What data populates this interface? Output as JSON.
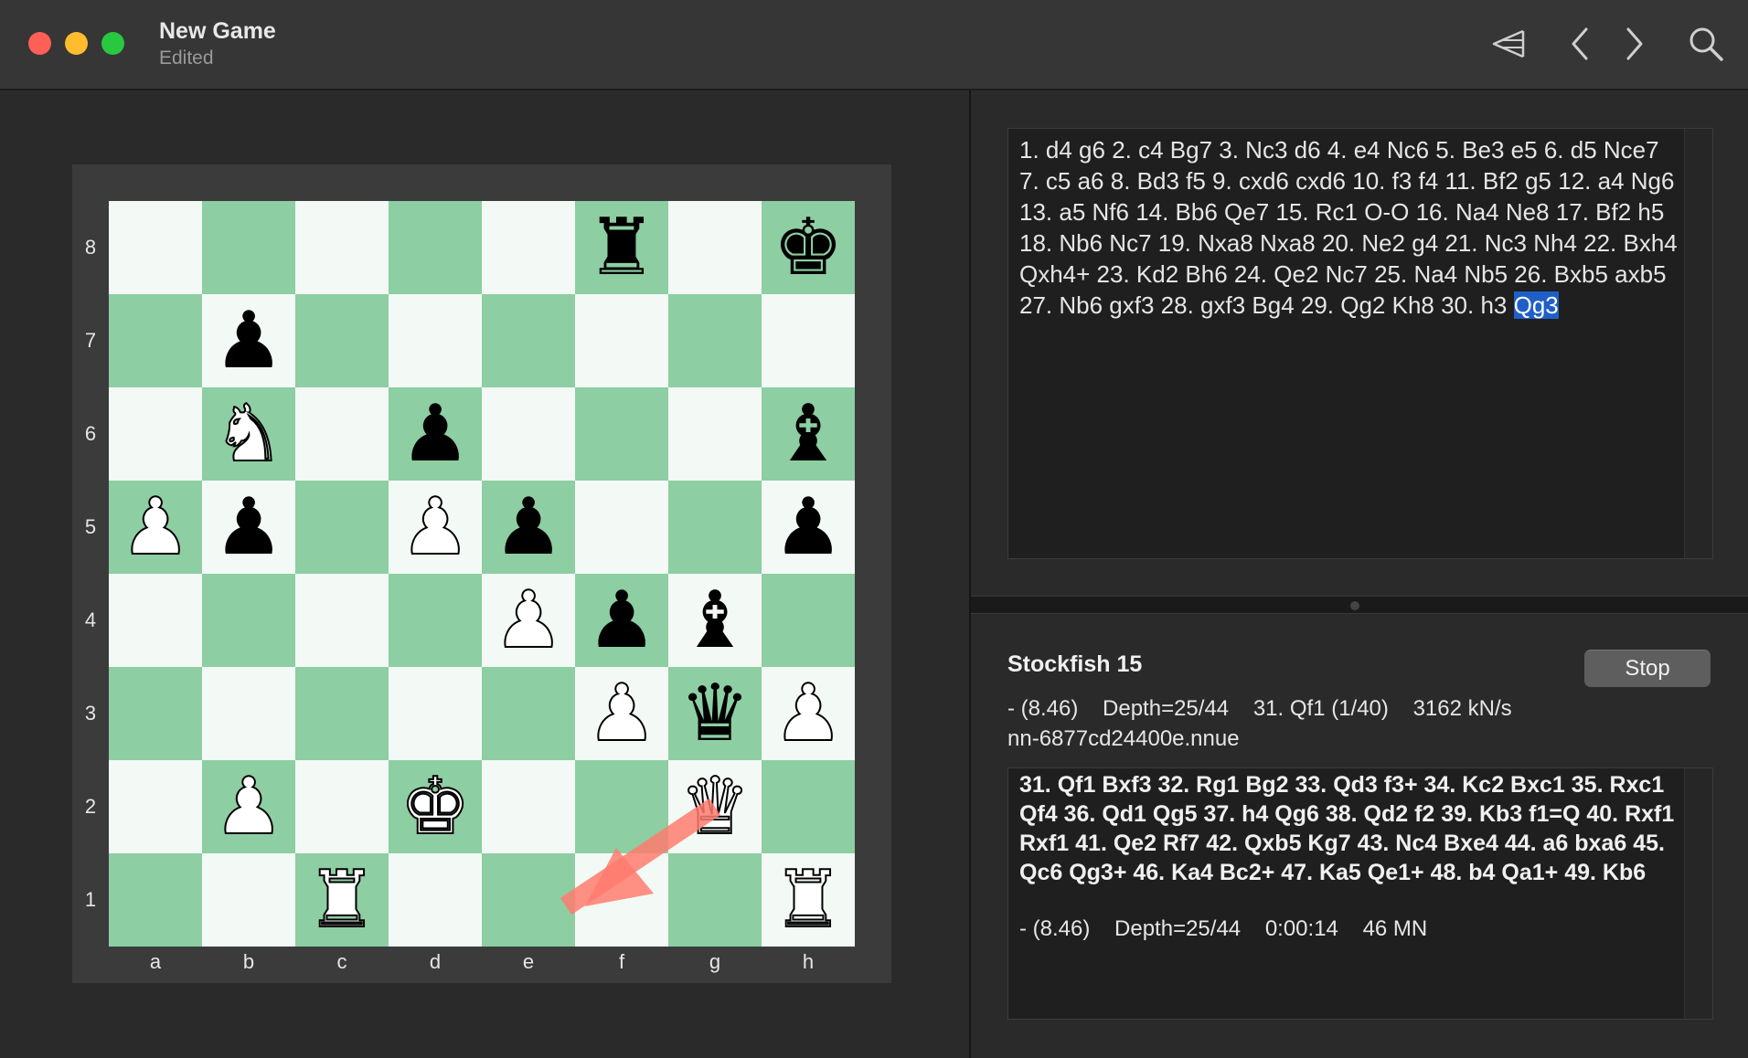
{
  "window": {
    "title": "New Game",
    "subtitle": "Edited"
  },
  "toolbar": {
    "icons": [
      "flip-board-icon",
      "chevron-left-icon",
      "chevron-right-icon",
      "search-icon"
    ]
  },
  "board": {
    "ranks": [
      "8",
      "7",
      "6",
      "5",
      "4",
      "3",
      "2",
      "1"
    ],
    "files": [
      "a",
      "b",
      "c",
      "d",
      "e",
      "f",
      "g",
      "h"
    ],
    "rows": [
      [
        "",
        "",
        "",
        "",
        "",
        "r",
        "",
        "k"
      ],
      [
        "",
        "p",
        "",
        "",
        "",
        "",
        "",
        ""
      ],
      [
        "",
        "N",
        "",
        "p",
        "",
        "",
        "",
        "b"
      ],
      [
        "P",
        "p",
        "",
        "P",
        "p",
        "",
        "",
        "p"
      ],
      [
        "",
        "",
        "",
        "",
        "P",
        "p",
        "b",
        ""
      ],
      [
        "",
        "",
        "",
        "",
        "",
        "P",
        "q",
        "P"
      ],
      [
        "",
        "P",
        "",
        "K",
        "",
        "",
        "Q",
        ""
      ],
      [
        "",
        "",
        "R",
        "",
        "",
        "",
        "",
        "R"
      ]
    ],
    "arrow": {
      "from": "g2",
      "to": "f1",
      "color": "#ff7b6e"
    }
  },
  "notation": {
    "moves": "1. d4 g6 2. c4 Bg7 3. Nc3 d6 4. e4 Nc6 5. Be3 e5 6. d5 Nce7 7. c5 a6 8. Bd3 f5 9. cxd6 cxd6 10. f3 f4 11. Bf2 g5 12. a4 Ng6 13. a5 Nf6 14. Bb6 Qe7 15. Rc1 O-O 16. Na4 Ne8 17. Bf2 h5 18. Nb6 Nc7 19. Nxa8 Nxa8 20. Ne2 g4 21. Nc3 Nh4 22. Bxh4 Qxh4+ 23. Kd2 Bh6 24. Qe2 Nc7 25. Na4 Nb5 26. Bxb5 axb5 27. Nb6 gxf3 28. gxf3 Bg4 29. Qg2 Kh8 30. h3",
    "current_move": "Qg3"
  },
  "engine": {
    "name": "Stockfish 15",
    "stop_label": "Stop",
    "stats": "- (8.46)    Depth=25/44    31. Qf1 (1/40)    3162 kN/s",
    "network": "nn-6877cd24400e.nnue",
    "pv": "31. Qf1 Bxf3 32. Rg1 Bg2 33. Qd3 f3+ 34. Kc2 Bxc1 35. Rxc1 Qf4 36. Qd1 Qg5 37. h4 Qg6 38. Qd2 f2 39. Kb3 f1=Q 40. Rxf1 Rxf1 41. Qe2 Rf7 42. Qxb5 Kg7 43. Nc4 Bxe4 44. a6 bxa6 45. Qc6 Qg3+ 46. Ka4 Bc2+ 47. Ka5 Qe1+ 48. b4 Qa1+ 49. Kb6",
    "pv_stats": "- (8.46)    Depth=25/44    0:00:14    46 MN"
  },
  "colors": {
    "light_square": "#f3faf5",
    "dark_square": "#8dcea2",
    "highlight": "#1f5fc8"
  }
}
